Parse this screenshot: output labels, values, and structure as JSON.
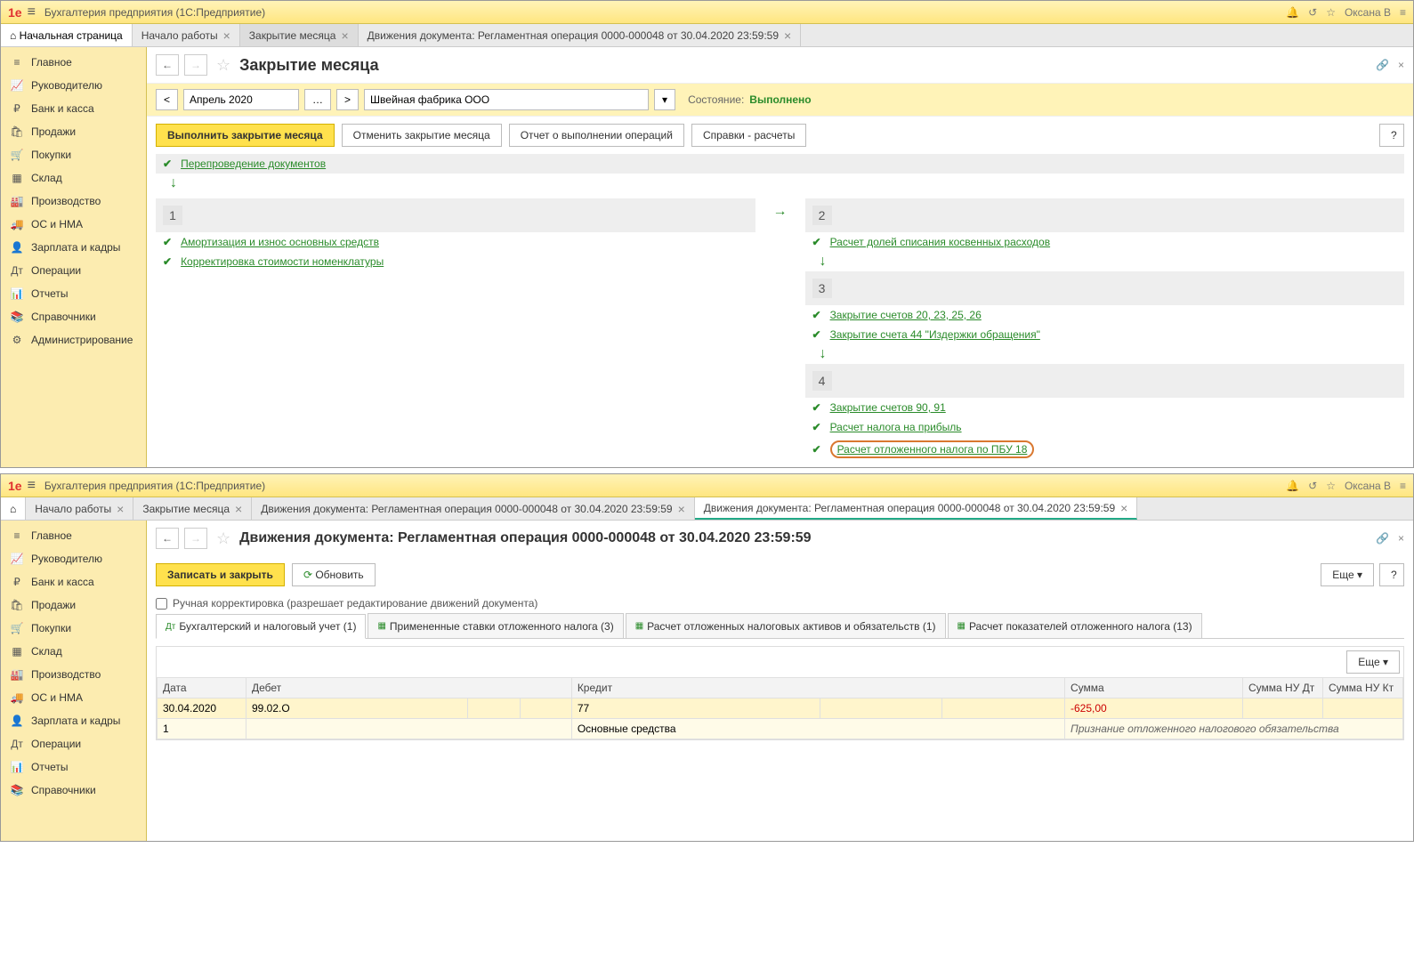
{
  "app": {
    "title": "Бухгалтерия предприятия  (1С:Предприятие)",
    "user": "Оксана В"
  },
  "tabs1": {
    "home": "Начальная страница",
    "t1": "Начало работы",
    "t2": "Закрытие месяца",
    "t3": "Движения документа: Регламентная операция 0000-000048 от 30.04.2020 23:59:59"
  },
  "sidebar": [
    "Главное",
    "Руководителю",
    "Банк и касса",
    "Продажи",
    "Покупки",
    "Склад",
    "Производство",
    "ОС и НМА",
    "Зарплата и кадры",
    "Операции",
    "Отчеты",
    "Справочники",
    "Администрирование"
  ],
  "page1": {
    "title": "Закрытие месяца",
    "period": "Апрель 2020",
    "org": "Швейная фабрика ООО",
    "stateLabel": "Состояние:",
    "stateVal": "Выполнено",
    "btnRun": "Выполнить закрытие месяца",
    "btnCancel": "Отменить закрытие месяца",
    "btnReport": "Отчет о выполнении операций",
    "btnRef": "Справки - расчеты",
    "reconduct": "Перепроведение документов",
    "c1a": "Амортизация и износ основных средств",
    "c1b": "Корректировка стоимости номенклатуры",
    "c2a": "Расчет долей списания косвенных расходов",
    "c3a": "Закрытие счетов 20, 23, 25, 26",
    "c3b": "Закрытие счета 44 \"Издержки обращения\"",
    "c4a": "Закрытие счетов 90, 91",
    "c4b": "Расчет налога на прибыль",
    "c4c": "Расчет отложенного налога по ПБУ 18"
  },
  "tabs2": {
    "t1": "Начало работы",
    "t2": "Закрытие месяца",
    "t3": "Движения документа: Регламентная операция 0000-000048 от 30.04.2020 23:59:59",
    "t4": "Движения документа: Регламентная операция 0000-000048 от 30.04.2020 23:59:59"
  },
  "page2": {
    "title": "Движения документа: Регламентная операция 0000-000048 от 30.04.2020 23:59:59",
    "btnSave": "Записать и закрыть",
    "btnRefresh": "Обновить",
    "btnMore": "Еще",
    "manual": "Ручная корректировка (разрешает редактирование движений документа)",
    "itabs": {
      "a": "Бухгалтерский и налоговый учет (1)",
      "b": "Примененные ставки отложенного налога (3)",
      "c": "Расчет отложенных налоговых активов и обязательств (1)",
      "d": "Расчет показателей отложенного налога (13)"
    },
    "cols": {
      "date": "Дата",
      "debit": "Дебет",
      "credit": "Кредит",
      "sum": "Сумма",
      "nud": "Сумма НУ Дт",
      "nuk": "Сумма НУ Кт"
    },
    "row": {
      "date": "30.04.2020",
      "n": "1",
      "debit": "99.02.О",
      "credit": "77",
      "sum": "-625,00",
      "desc1": "Основные средства",
      "desc2": "Признание отложенного налогового обязательства"
    }
  }
}
